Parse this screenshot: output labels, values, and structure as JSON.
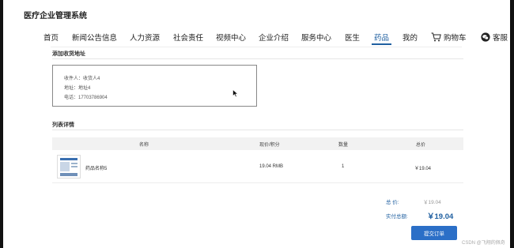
{
  "app_title": "医疗企业管理系统",
  "nav": {
    "items": [
      "首页",
      "新闻公告信息",
      "人力资源",
      "社会责任",
      "视频中心",
      "企业介绍",
      "服务中心",
      "医生",
      "药品",
      "我的"
    ],
    "active": "药品",
    "cart_label": "购物车",
    "service_label": "客服",
    "cart_icon": "cart-icon",
    "service_icon": "wechat-icon"
  },
  "address": {
    "section_title": "添加收货地址",
    "recipient": "收件人：收货人4",
    "address_line": "地址：地址4",
    "phone": "电话：17703786904"
  },
  "list": {
    "section_title": "列表详情",
    "columns": [
      "名称",
      "现价/积分",
      "数量",
      "总价"
    ],
    "rows": [
      {
        "name": "药品名称5",
        "price": "19.04 RMB",
        "qty": "1",
        "total": "￥19.04"
      }
    ]
  },
  "summary": {
    "total_label": "总 价:",
    "total_value": "￥19.04",
    "paid_label": "实付总额:",
    "paid_value": "￥19.04",
    "submit_label": "提交订单"
  },
  "watermark": "CSDN @飞翔的佩奇",
  "colors": {
    "accent": "#1f5fa0",
    "button": "#2b6fc7",
    "frame_background": "#111111"
  }
}
